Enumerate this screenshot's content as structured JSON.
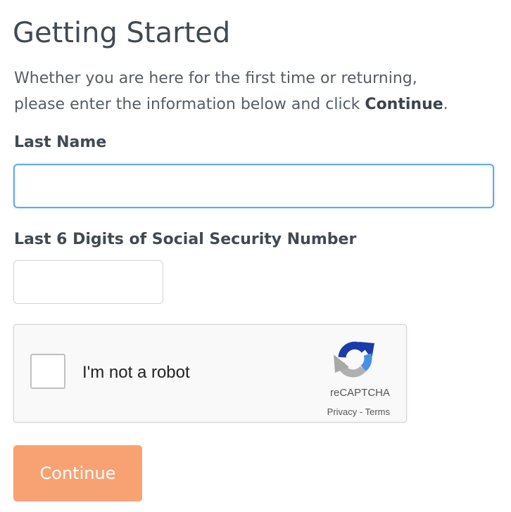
{
  "form": {
    "title": "Getting Started",
    "intro_line1": "Whether you are here for the first time or returning,",
    "intro_line2_prefix": "please enter the information below and click ",
    "intro_line2_bold": "Continue",
    "intro_line2_suffix": ".",
    "last_name_label": "Last Name",
    "last_name_value": "",
    "ssn_label": "Last 6 Digits of Social Security Number",
    "ssn_value": "",
    "continue_label": "Continue"
  },
  "captcha": {
    "label": "I'm not a robot",
    "brand": "reCAPTCHA",
    "privacy_label": "Privacy",
    "separator": " - ",
    "terms_label": "Terms",
    "checked": false,
    "icon": "recaptcha-logo-icon"
  },
  "colors": {
    "accent_button": "#f8a274",
    "focus_border": "#66a9e8",
    "text": "#404a52"
  }
}
